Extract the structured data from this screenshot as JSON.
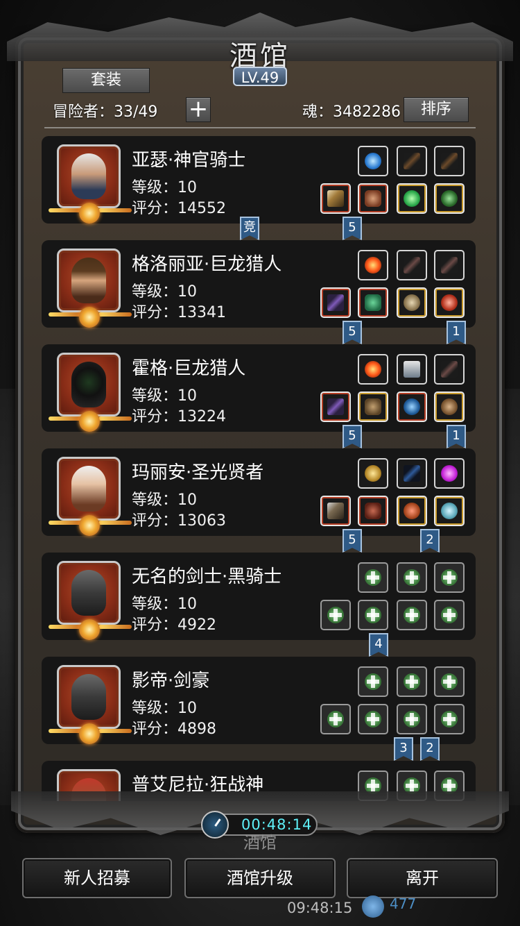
{
  "header": {
    "title": "酒馆",
    "level": "LV.49",
    "suit_label": "套装",
    "sort_label": "排序",
    "adventurers_text": "冒险者：33/49",
    "soul_text": "魂：3482286",
    "plus_symbol": "+"
  },
  "heroes": [
    {
      "name": "亚瑟·神官骑士",
      "level": "等级：10",
      "score": "评分：14552",
      "tags": [
        "竞",
        "5"
      ],
      "equip_top": [
        "blue orb",
        "dark gun",
        "dark gun"
      ],
      "equip_bottom": [
        "hammer",
        "armor",
        "green gem",
        "green boots"
      ]
    },
    {
      "name": "格洛丽亚·巨龙猎人",
      "level": "等级：10",
      "score": "评分：13341",
      "tags": [
        "5",
        "1"
      ],
      "equip_top": [
        "fire",
        "feather",
        "feather"
      ],
      "equip_bottom": [
        "crossbow",
        "green armor",
        "ring",
        "red gem"
      ]
    },
    {
      "name": "霍格·巨龙猎人",
      "level": "等级：10",
      "score": "评分：13224",
      "tags": [
        "5",
        "1"
      ],
      "equip_top": [
        "fire",
        "crystal",
        "feather"
      ],
      "equip_bottom": [
        "crossbow",
        "leather armor",
        "blue gauntlet",
        "paw"
      ]
    },
    {
      "name": "玛丽安·圣光贤者",
      "level": "等级：10",
      "score": "评分：13063",
      "tags": [
        "5",
        "2"
      ],
      "equip_top": [
        "golden shield",
        "bow",
        "purple crystal"
      ],
      "equip_bottom": [
        "hammer",
        "robe",
        "amulet",
        "necklace"
      ]
    },
    {
      "name": "无名的剑士·黑骑士",
      "level": "等级：10",
      "score": "评分：4922",
      "tags": [
        "4"
      ],
      "equip_top": [
        "empty",
        "empty",
        "empty"
      ],
      "equip_bottom": [
        "empty",
        "empty",
        "empty",
        "empty"
      ]
    },
    {
      "name": "影帝·剑豪",
      "level": "等级：10",
      "score": "评分：4898",
      "tags": [
        "3",
        "2"
      ],
      "equip_top": [
        "empty",
        "empty",
        "empty"
      ],
      "equip_bottom": [
        "empty",
        "empty",
        "empty",
        "empty"
      ]
    },
    {
      "name": "普艾尼拉·狂战神",
      "level": "",
      "score": "",
      "tags": [],
      "equip_top": [
        "empty",
        "empty",
        "empty"
      ],
      "equip_bottom": []
    }
  ],
  "timer": "00:48:14",
  "under_title": "酒馆",
  "buttons": {
    "recruit": "新人招募",
    "upgrade": "酒馆升级",
    "leave": "离开"
  },
  "status": {
    "clock": "09:48:15",
    "currency": "477"
  },
  "colors": {
    "timer_text": "#5ef0f8",
    "tag_bg": "#2f5a86",
    "portrait_bg": "#8a2d17"
  }
}
